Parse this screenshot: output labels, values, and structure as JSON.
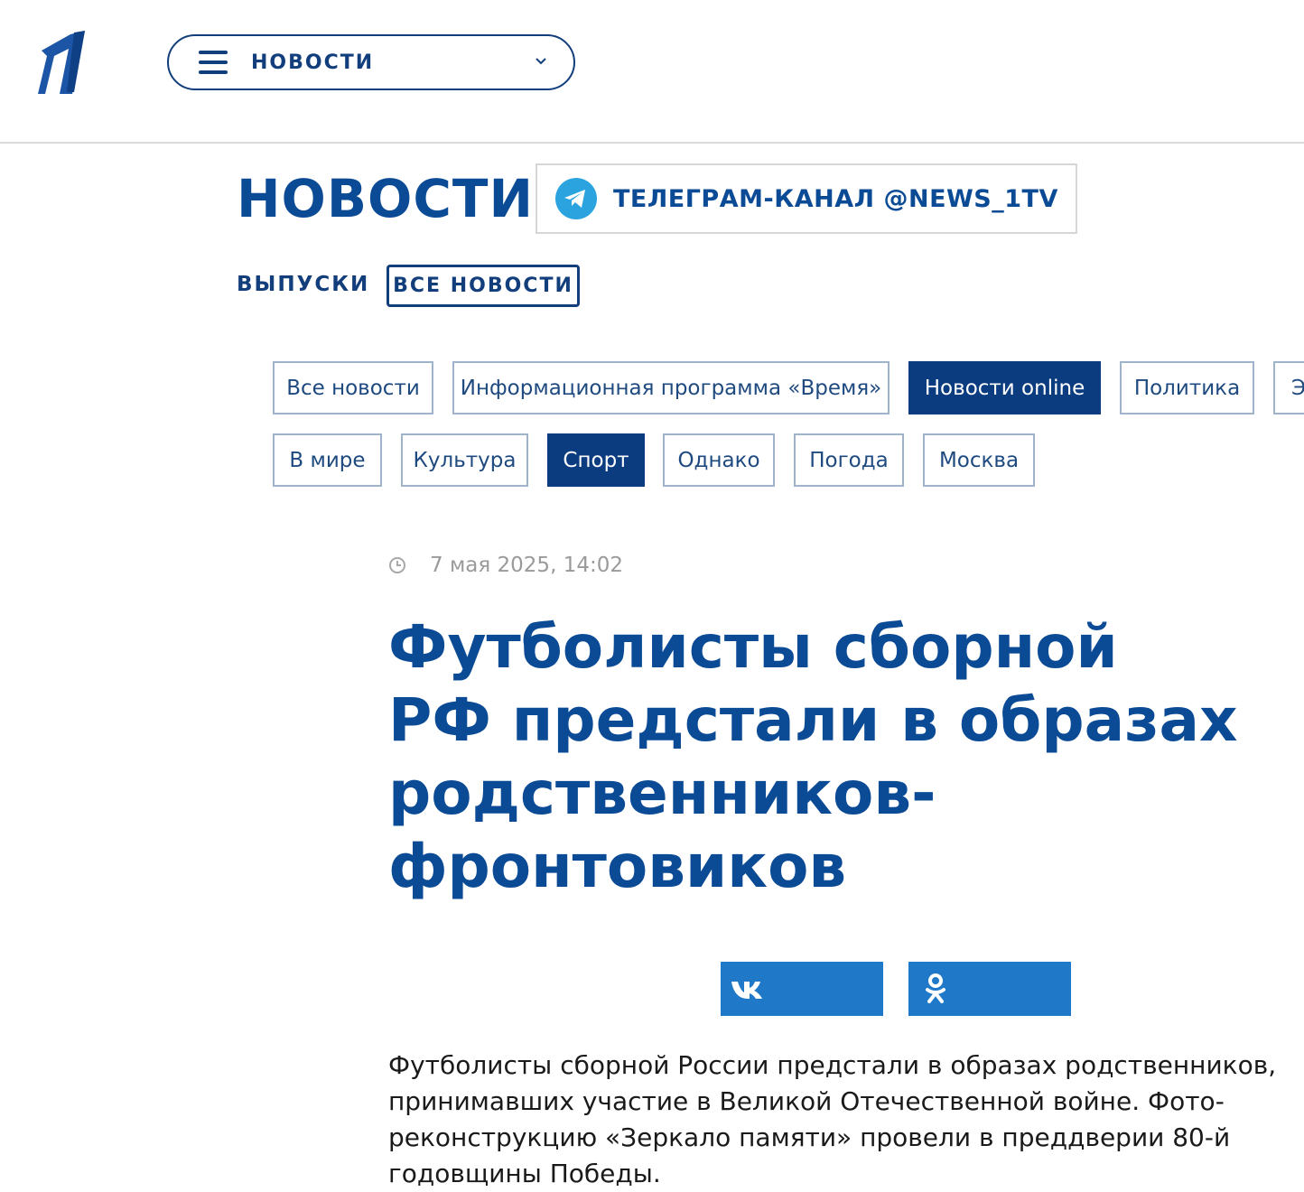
{
  "header": {
    "menu_label": "НОВОСТИ"
  },
  "section": {
    "title": "НОВОСТИ",
    "telegram_label": "ТЕЛЕГРАМ-КАНАЛ @NEWS_1TV"
  },
  "subnav": {
    "releases": "ВЫПУСКИ",
    "all_news": "ВСЕ НОВОСТИ"
  },
  "categories": [
    {
      "label": "Все новости",
      "active": false
    },
    {
      "label": "Информационная программа «Время»",
      "active": false
    },
    {
      "label": "Новости online",
      "active": true
    },
    {
      "label": "Политика",
      "active": false
    },
    {
      "label": "Э",
      "active": false
    },
    {
      "label": "В мире",
      "active": false
    },
    {
      "label": "Культура",
      "active": false
    },
    {
      "label": "Спорт",
      "active": true
    },
    {
      "label": "Однако",
      "active": false
    },
    {
      "label": "Погода",
      "active": false
    },
    {
      "label": "Москва",
      "active": false
    }
  ],
  "article": {
    "date": "7 мая 2025, 14:02",
    "headline_lines": [
      "Футболисты сборной",
      "РФ предстали в образах",
      "родственников-фронтовиков"
    ],
    "lead": "Футболисты сборной России предстали в образах родственников, принимавших участие в Великой Отечественной войне. Фото-реконструкцию «Зеркало памяти» провели в преддверии 80-й годовщины Победы."
  },
  "colors": {
    "brand_blue": "#0b4b96",
    "active_chip": "#0b3c80",
    "share_blue": "#1f78c8",
    "telegram": "#2aa3df"
  },
  "icons": {
    "logo": "channel-one-logo",
    "menu": "hamburger-icon",
    "dropdown": "chevron-down-icon",
    "telegram": "telegram-icon",
    "clock": "clock-icon",
    "vk": "vk-icon",
    "ok": "odnoklassniki-icon"
  }
}
